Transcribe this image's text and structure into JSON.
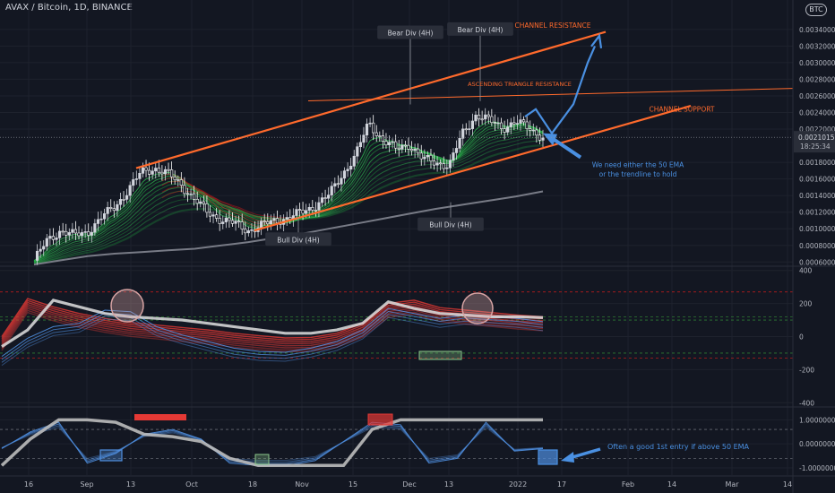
{
  "header": {
    "symbol": "AVAX / Bitcoin, 1D, BINANCE",
    "currency_badge": "BTC"
  },
  "colors": {
    "background": "#131722",
    "grid": "#1e222d",
    "up_candle": "#d1d4dc",
    "down_candle": "#ffffff",
    "fast_ribbon": "#26a641",
    "slow_ribbon": "#b71c1c",
    "ema_200": "#787b86",
    "drawing": "#ff6a2c",
    "arrow": "#4a90e2",
    "bull_box": "#8bc78b",
    "bear_box": "#d8a4a4",
    "ind_red": "#e53935",
    "ind_blue": "#4f8fe0",
    "ind_white": "#e0e0e0"
  },
  "chart_data": [
    {
      "type": "candlestick",
      "title": "AVAX / Bitcoin, 1D, BINANCE",
      "x_tick_labels": [
        "16",
        "Sep",
        "13",
        "Oct",
        "18",
        "Nov",
        "15",
        "Dec",
        "13",
        "2022",
        "17",
        "Feb",
        "14",
        "Mar",
        "14"
      ],
      "y_tick_labels": [
        "0.0006000",
        "0.0008000",
        "0.0010000",
        "0.0012000",
        "0.0014000",
        "0.0016000",
        "0.0018000",
        "0.0022000",
        "0.0024000",
        "0.0026000",
        "0.0028000",
        "0.0030000",
        "0.0032000",
        "0.0034000"
      ],
      "ylim": [
        0.00056,
        0.00356
      ],
      "last_price": "0.0021015",
      "countdown": "18:25:34",
      "grid": true,
      "close_path": [
        0.00062,
        0.00086,
        0.00098,
        0.00092,
        0.00096,
        0.00113,
        0.00126,
        0.00146,
        0.00168,
        0.00173,
        0.00166,
        0.00153,
        0.00135,
        0.00119,
        0.00111,
        0.00106,
        0.00098,
        0.00104,
        0.0011,
        0.00113,
        0.0012,
        0.00128,
        0.0014,
        0.00165,
        0.00188,
        0.00228,
        0.00207,
        0.00196,
        0.00202,
        0.00184,
        0.0018,
        0.00176,
        0.00215,
        0.00237,
        0.0023,
        0.00222,
        0.00228,
        0.00221,
        0.0021
      ],
      "ema_200_path": [
        0.00057,
        0.00062,
        0.00067,
        0.0007,
        0.00072,
        0.00074,
        0.00076,
        0.0008,
        0.00084,
        0.00089,
        0.00094,
        0.001,
        0.00106,
        0.00112,
        0.00118,
        0.00124,
        0.00129,
        0.00134,
        0.00139,
        0.00145
      ],
      "annotations": [
        {
          "text": "Bear Div (4H)",
          "x": 458,
          "y": 0.00336,
          "kind": "label"
        },
        {
          "text": "Bear Div (4H)",
          "x": 536,
          "y": 0.0034,
          "kind": "label"
        },
        {
          "text": "Bull Div (4H)",
          "x": 333,
          "y": 0.00087,
          "kind": "label"
        },
        {
          "text": "Bull Div (4H)",
          "x": 503,
          "y": 0.00105,
          "kind": "label"
        },
        {
          "text": "CHANNEL RESISTANCE",
          "x": 617,
          "y": 0.00342,
          "kind": "note"
        },
        {
          "text": "ASCENDING TRIANGLE RESISTANCE",
          "x": 580,
          "y": 0.00272,
          "kind": "note"
        },
        {
          "text": "CHANNEL SUPPORT",
          "x": 761,
          "y": 0.00241,
          "kind": "note"
        },
        {
          "text": "We need either the 50 EMA",
          "x": 712,
          "y": 0.00174,
          "kind": "note"
        },
        {
          "text": "or the trendline to hold",
          "x": 712,
          "y": 0.00163,
          "kind": "note"
        }
      ],
      "lines": [
        {
          "name": "CHANNEL RESISTANCE",
          "x1": 152,
          "y1": 0.00173,
          "x2": 676,
          "y2": 0.00337
        },
        {
          "name": "CHANNEL SUPPORT",
          "x1": 284,
          "y1": 0.00098,
          "x2": 771,
          "y2": 0.00248
        },
        {
          "name": "ASCENDING TRIANGLE RESISTANCE",
          "x1": 344,
          "y1": 0.00254,
          "x2": 885,
          "y2": 0.00269
        }
      ]
    },
    {
      "type": "line",
      "y_tick_labels": [
        "400",
        "200",
        "0",
        "-200",
        "-400"
      ],
      "ylim": [
        -420,
        420
      ],
      "grid": true,
      "red_ribbon": [
        0,
        230,
        180,
        140,
        110,
        85,
        70,
        55,
        40,
        20,
        5,
        -8,
        -5,
        20,
        80,
        200,
        220,
        175,
        160,
        145,
        130,
        120
      ],
      "blue_signal": [
        -120,
        -10,
        60,
        80,
        160,
        150,
        60,
        10,
        -30,
        -70,
        -90,
        -95,
        -70,
        -30,
        40,
        170,
        140,
        110,
        130,
        120,
        110,
        90
      ],
      "white_line": [
        -60,
        40,
        220,
        180,
        140,
        120,
        110,
        100,
        80,
        60,
        40,
        20,
        20,
        40,
        80,
        210,
        170,
        140,
        130,
        120,
        120,
        115
      ],
      "dashed_levels": [
        270,
        120,
        100,
        -100,
        -130
      ]
    },
    {
      "type": "line",
      "y_tick_labels": [
        "1.0000000",
        "0.0000000",
        "-1.0000000"
      ],
      "ylim": [
        -1.3,
        1.5
      ],
      "grid": true,
      "white_line": [
        -0.9,
        0.2,
        1.0,
        1.0,
        0.9,
        0.4,
        0.3,
        0.1,
        -0.6,
        -0.9,
        -0.9,
        -0.9,
        -0.9,
        0.6,
        1.0,
        1.0,
        1.0,
        1.0,
        1.0,
        1.0
      ],
      "blue_signal": [
        -0.2,
        0.5,
        0.9,
        -0.8,
        -0.4,
        0.4,
        0.6,
        0.2,
        -0.8,
        -0.9,
        -0.9,
        -0.7,
        0.1,
        0.9,
        0.8,
        -0.8,
        -0.6,
        0.9,
        -0.3,
        -0.2
      ],
      "dashed_levels": [
        0.6,
        -0.6
      ],
      "annotation": "Often a good 1st entry if above 50 EMA"
    }
  ]
}
